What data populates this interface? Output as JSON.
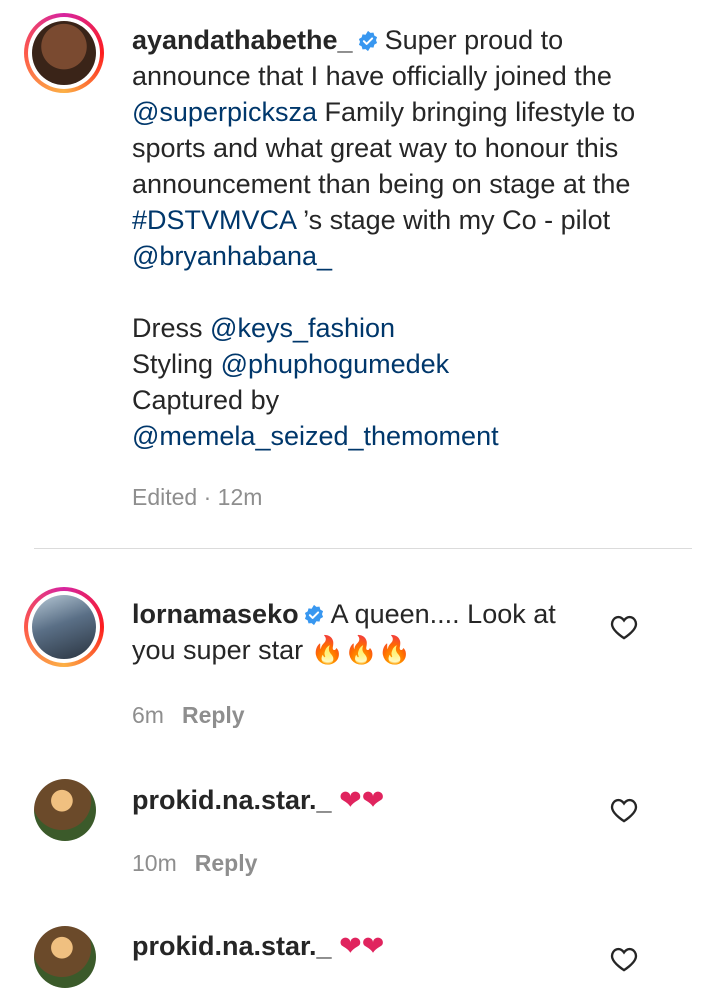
{
  "post": {
    "username": "ayandathabethe_",
    "caption_lines": [
      "Super proud to",
      "announce that I have officially joined the",
      "Family bringing lifestyle to",
      "sports and what great way to honour this",
      "announcement than being on stage at the",
      "’s stage with my Co - pilot"
    ],
    "mention_superpicks": "@superpicksza",
    "hashtag": "#DSTVMVCA",
    "mention_bryan": "@bryanhabana_",
    "dress_label": "Dress",
    "dress_mention": "@keys_fashion",
    "styling_label": "Styling",
    "styling_mention": "@phuphogumedek",
    "captured_label": "Captured by",
    "captured_mention": "@memela_seized_themoment",
    "meta": "Edited · 12m"
  },
  "comments": [
    {
      "username": "lornamaseko",
      "text_line1": "A queen.... Look at",
      "text_line2": "you super star",
      "emojis": "🔥🔥🔥",
      "time": "6m",
      "reply_label": "Reply"
    },
    {
      "username": "prokid.na.star._",
      "emojis": "❤❤",
      "time": "10m",
      "reply_label": "Reply"
    },
    {
      "username": "prokid.na.star._",
      "emojis": "❤❤"
    }
  ],
  "colors": {
    "text": "#262626",
    "link": "#00376b",
    "meta": "#8e8e8e",
    "verified": "#3897f0",
    "heart_emoji": "#e0245e",
    "fire_emoji": "#f4900c"
  },
  "icons": {
    "verified": "verified-badge-icon",
    "like": "heart-outline-icon"
  }
}
